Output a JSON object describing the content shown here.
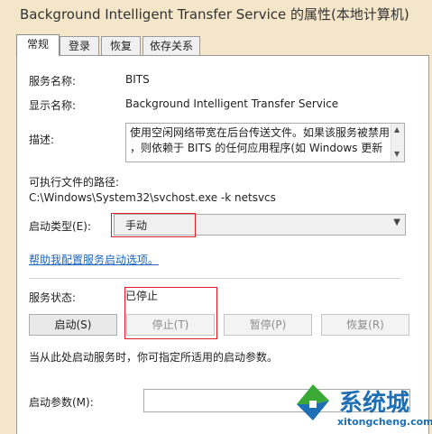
{
  "window": {
    "title": "Background Intelligent Transfer Service 的属性(本地计算机)"
  },
  "tabs": [
    {
      "label": "常规",
      "active": true
    },
    {
      "label": "登录",
      "active": false
    },
    {
      "label": "恢复",
      "active": false
    },
    {
      "label": "依存关系",
      "active": false
    }
  ],
  "general": {
    "service_name_label": "服务名称:",
    "service_name_value": "BITS",
    "display_name_label": "显示名称:",
    "display_name_value": "Background Intelligent Transfer Service",
    "description_label": "描述:",
    "description_line1": "使用空闲网络带宽在后台传送文件。如果该服务被禁用",
    "description_line2": "，则依赖于 BITS 的任何应用程序(如 Windows 更新",
    "exe_path_label": "可执行文件的路径:",
    "exe_path_value": "C:\\Windows\\System32\\svchost.exe -k netsvcs",
    "startup_type_label": "启动类型(E):",
    "startup_type_value": "手动",
    "help_link": "帮助我配置服务启动选项。",
    "status_label": "服务状态:",
    "status_value": "已停止",
    "buttons": {
      "start": "启动(S)",
      "stop": "停止(T)",
      "pause": "暂停(P)",
      "resume": "恢复(R)"
    },
    "hint": "当从此处启动服务时，你可指定所适用的启动参数。",
    "params_label": "启动参数(M):",
    "params_value": ""
  },
  "watermark": {
    "text": "系统城",
    "url": "xitongcheng.com"
  },
  "colors": {
    "highlight_red": "#e02020",
    "link": "#1a65c1",
    "brand_blue": "#1e6fb3",
    "brand_green": "#3aa935"
  }
}
